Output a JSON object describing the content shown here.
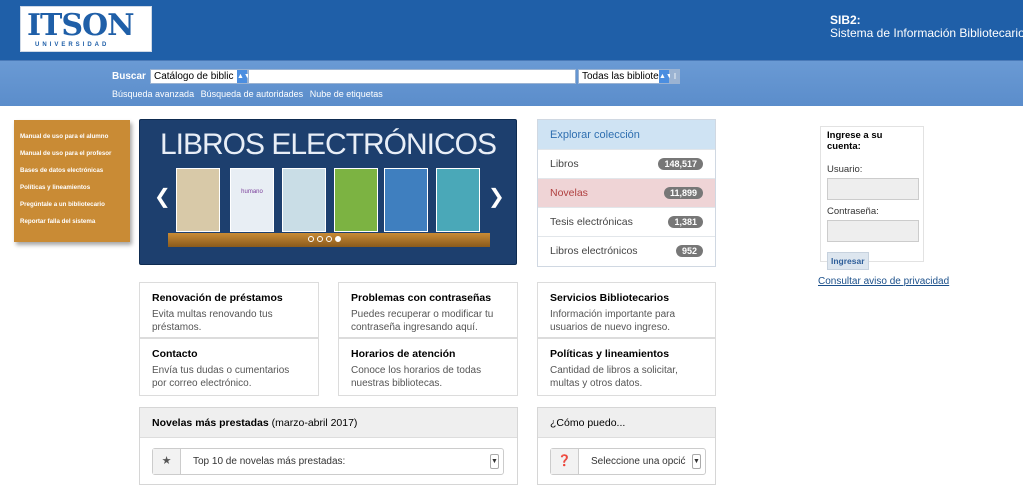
{
  "header": {
    "logo_text": "ITSON",
    "logo_sub": "UNIVERSIDAD",
    "system_title": "SIB2:",
    "system_subtitle": "Sistema de Información Bibliotecario 2"
  },
  "search": {
    "label": "Buscar",
    "catalog_value": "Catálogo de biblic",
    "query_value": "",
    "library_value": "Todas las bibliote",
    "go_label": "I",
    "links": [
      "Búsqueda avanzada",
      "Búsqueda de autoridades",
      "Nube de etiquetas"
    ]
  },
  "leftmenu": {
    "items": [
      "Manual de uso para el alumno",
      "Manual de uso para el profesor",
      "Bases de datos electrónicas",
      "Políticas y lineamientos",
      "Pregúntale a un bibliotecario",
      "Reportar falla del sistema"
    ]
  },
  "carousel": {
    "title": "LIBROS ELECTRÓNICOS",
    "books": [
      "",
      "humano",
      "",
      "",
      "",
      ""
    ],
    "colors": {
      "background": "#1d3f6e",
      "shelf": "#c98b35"
    }
  },
  "explore": {
    "title": "Explorar colección",
    "items": [
      {
        "label": "Libros",
        "count": "148,517"
      },
      {
        "label": "Novelas",
        "count": "11,899"
      },
      {
        "label": "Tesis electrónicas",
        "count": "1,381"
      },
      {
        "label": "Libros electrónicos",
        "count": "952"
      }
    ]
  },
  "login": {
    "title": "Ingrese a su cuenta:",
    "user_label": "Usuario:",
    "pass_label": "Contraseña:",
    "button": "Ingresar",
    "privacy_link": "Consultar aviso de privacidad"
  },
  "info": [
    {
      "title": "Renovación de préstamos",
      "text": "Evita multas renovando tus préstamos."
    },
    {
      "title": "Problemas con contraseñas",
      "text": "Puedes recuperar o modificar tu contraseña ingresando aquí."
    },
    {
      "title": "Servicios Bibliotecarios",
      "text": "Información importante para usuarios de nuevo ingreso."
    },
    {
      "title": "Contacto",
      "text": "Envía tus dudas o cumentarios por correo electrónico."
    },
    {
      "title": "Horarios de atención",
      "text": "Conoce los horarios de todas nuestras bibliotecas."
    },
    {
      "title": "Políticas y lineamientos",
      "text": "Cantidad de libros a solicitar, multas y otros datos."
    }
  ],
  "panels": {
    "novels": {
      "title_bold": "Novelas más prestadas",
      "title_rest": " (marzo-abril 2017)",
      "select_value": "Top 10 de novelas más prestadas:"
    },
    "howto": {
      "title": "¿Cómo puedo...",
      "select_value": "Seleccione una opcić"
    }
  },
  "colors": {
    "header": "#1f5fa8",
    "searchbar": "#5b8dcb",
    "menu": "#c98b35",
    "explore_head": "#cfe3f3",
    "highlight": "#efd4d6"
  }
}
